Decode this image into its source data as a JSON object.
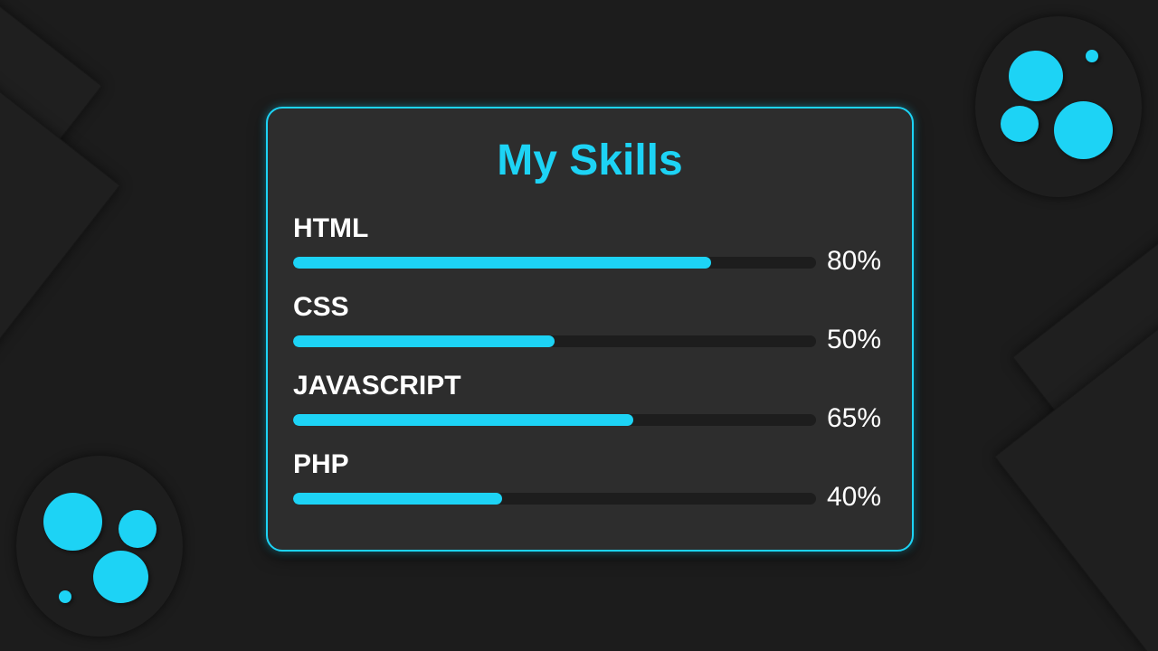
{
  "theme": {
    "accent": "#1dd3f5",
    "background": "#1c1c1c",
    "card_background": "#2d2d2d",
    "track_background": "#1d1d1d",
    "text": "#ffffff"
  },
  "card": {
    "title": "My Skills",
    "skills": [
      {
        "name": "HTML",
        "percent_label": "80%",
        "level": 0.8
      },
      {
        "name": "CSS",
        "percent_label": "50%",
        "level": 0.5
      },
      {
        "name": "JAVASCRIPT",
        "percent_label": "65%",
        "level": 0.65
      },
      {
        "name": "PHP",
        "percent_label": "40%",
        "level": 0.4
      }
    ]
  }
}
